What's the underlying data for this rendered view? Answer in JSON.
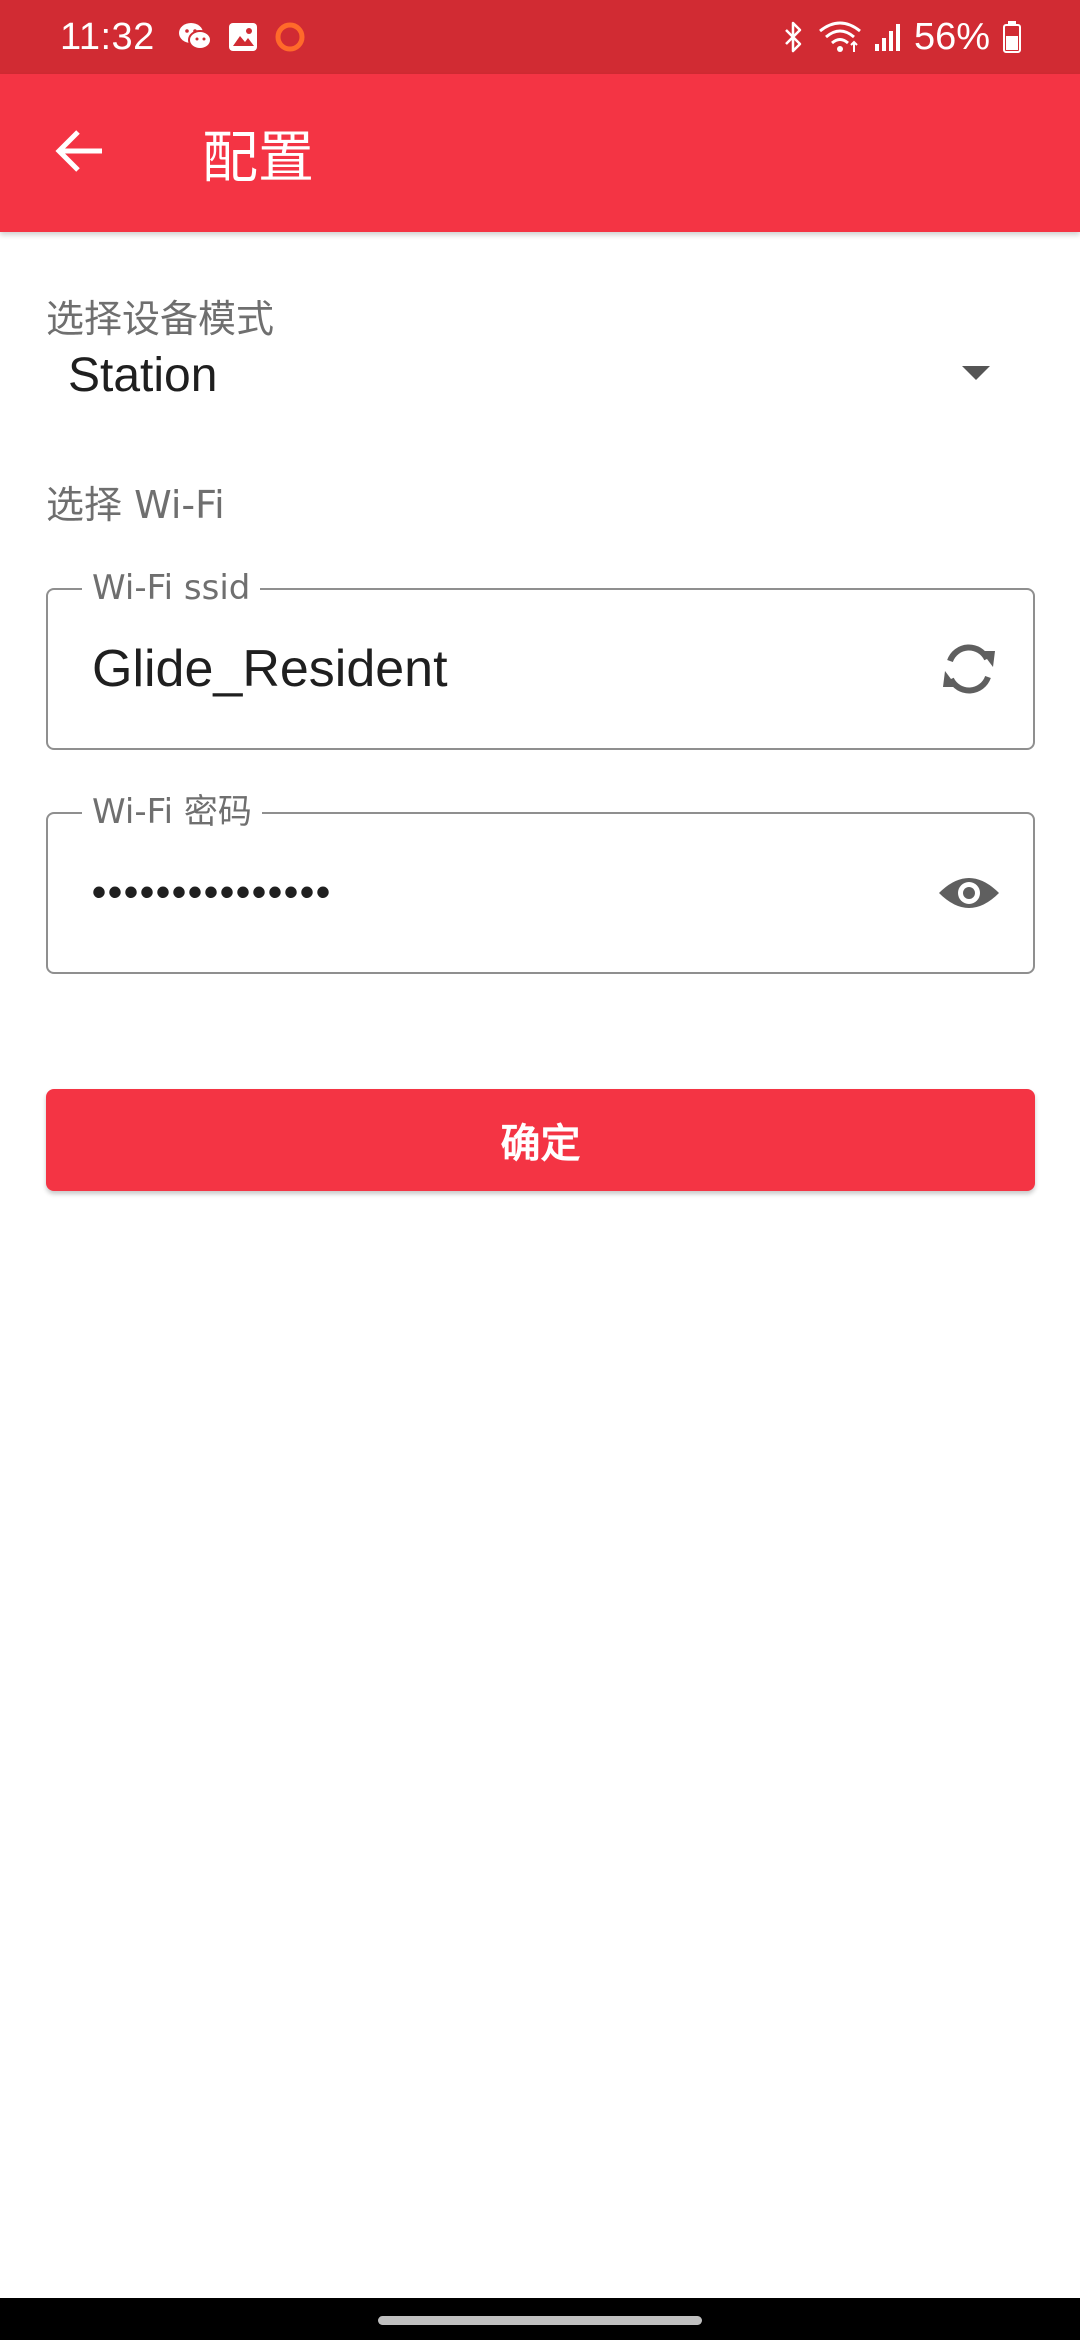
{
  "status_bar": {
    "time": "11:32",
    "battery_percent": "56%",
    "left_icons": [
      "wechat-icon",
      "gallery-icon",
      "circle-notification-icon"
    ],
    "right_icons": [
      "bluetooth-icon",
      "wifi-icon",
      "signal-icon",
      "battery-icon"
    ]
  },
  "app_bar": {
    "title": "配置",
    "back_icon": "arrow-left-icon",
    "color": "#f43444"
  },
  "form": {
    "mode_label": "选择设备模式",
    "mode_value": "Station",
    "wifi_section_label": "选择 Wi-Fi",
    "ssid_label": "Wi-Fi ssid",
    "ssid_value": "Glide_Resident",
    "password_label": "Wi-Fi 密码",
    "password_value": "•••••••••••••••",
    "confirm_label": "确定"
  },
  "colors": {
    "accent": "#f43444",
    "status_bar": "#d12b33"
  }
}
